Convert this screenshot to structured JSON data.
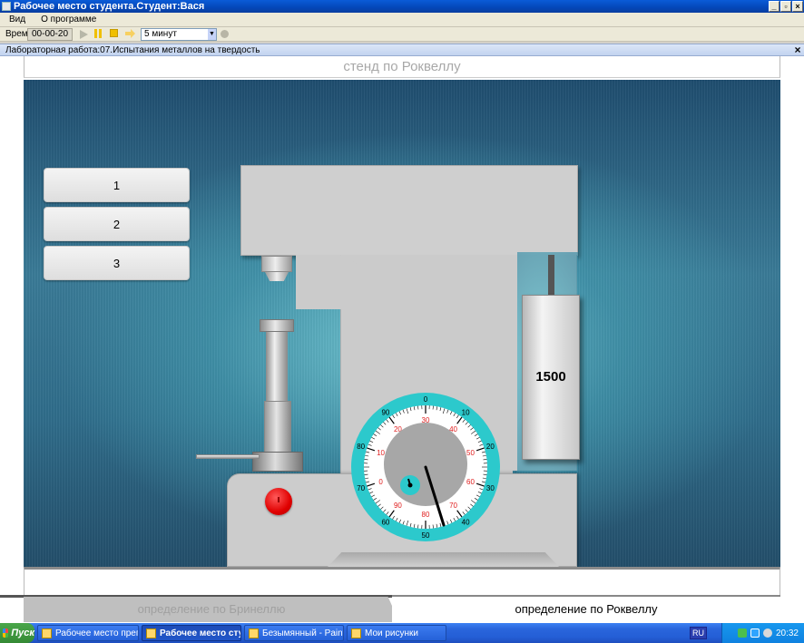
{
  "window": {
    "title": "Рабочее место студента.Студент:Вася"
  },
  "menu": {
    "items": [
      "Вид",
      "О программе"
    ]
  },
  "toolbar": {
    "time_label": "Время",
    "time_value": "00-00-20",
    "interval": "5 минут"
  },
  "document": {
    "title": "Лабораторная работа:07.Испытания металлов на твердость"
  },
  "stand": {
    "header": "стенд по Роквеллу",
    "levers": [
      "1",
      "2",
      "3"
    ],
    "weight_label": "1500",
    "dial": {
      "outer_labels": [
        "0",
        "10",
        "20",
        "30",
        "40",
        "50",
        "60",
        "70",
        "80",
        "90"
      ],
      "inner_labels": [
        "30",
        "40",
        "50",
        "60",
        "70",
        "80",
        "90",
        "0",
        "10",
        "20"
      ],
      "colors": {
        "ring": "#2cc9cc",
        "inner_red": "#e02020"
      }
    }
  },
  "tabs": {
    "brinell": "определение по Бринеллю",
    "rockwell": "определение по Роквеллу"
  },
  "taskbar": {
    "start": "Пуск",
    "tasks": [
      "Рабочее место препода...",
      "Рабочее место студ...",
      "Безымянный - Paint",
      "Мои рисунки"
    ],
    "lang": "RU",
    "clock": "20:32"
  }
}
